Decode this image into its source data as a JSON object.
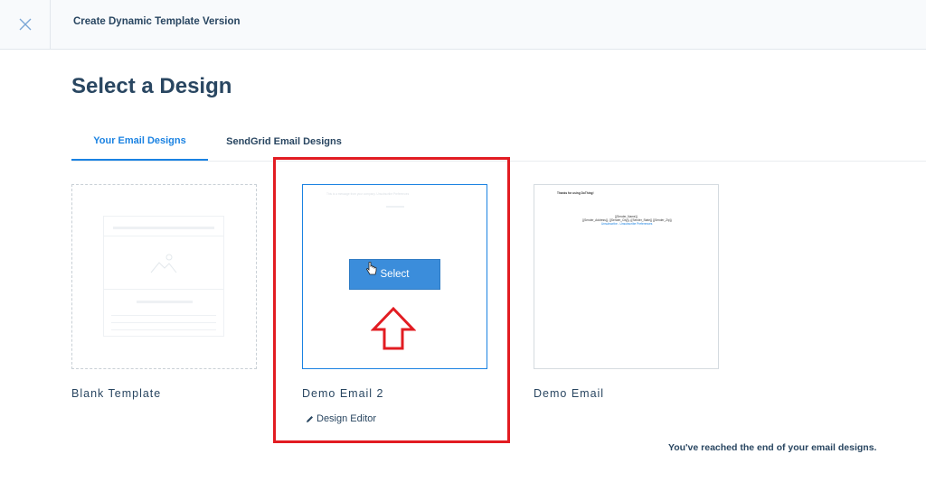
{
  "header": {
    "title": "Create Dynamic Template Version",
    "close_icon": "close-icon"
  },
  "page": {
    "title": "Select a Design"
  },
  "tabs": [
    {
      "label": "Your Email Designs",
      "active": true
    },
    {
      "label": "SendGrid Email Designs",
      "active": false
    }
  ],
  "cards": [
    {
      "name": "Blank Template"
    },
    {
      "name": "Demo Email 2",
      "select_label": "Select",
      "editor_label": "Design Editor",
      "editor_icon": "pencil-icon",
      "preview_text": "This is a message from your company. Unsubscribe Preferences"
    },
    {
      "name": "Demo Email",
      "preview_heading": "Thanks for using DoThing!",
      "preview_name": "{{Sender_Name}}",
      "preview_address": "{{Sender_Address}}, {{Sender_City}}, {{Sender_State}} {{Sender_Zip}}",
      "preview_links": "Unsubscribe - Unsubscribe Preferences"
    }
  ],
  "footer": {
    "end_message": "You've reached the end of your email designs."
  },
  "colors": {
    "accent": "#1a82e2",
    "text": "#294661",
    "highlight": "#e21c22"
  }
}
